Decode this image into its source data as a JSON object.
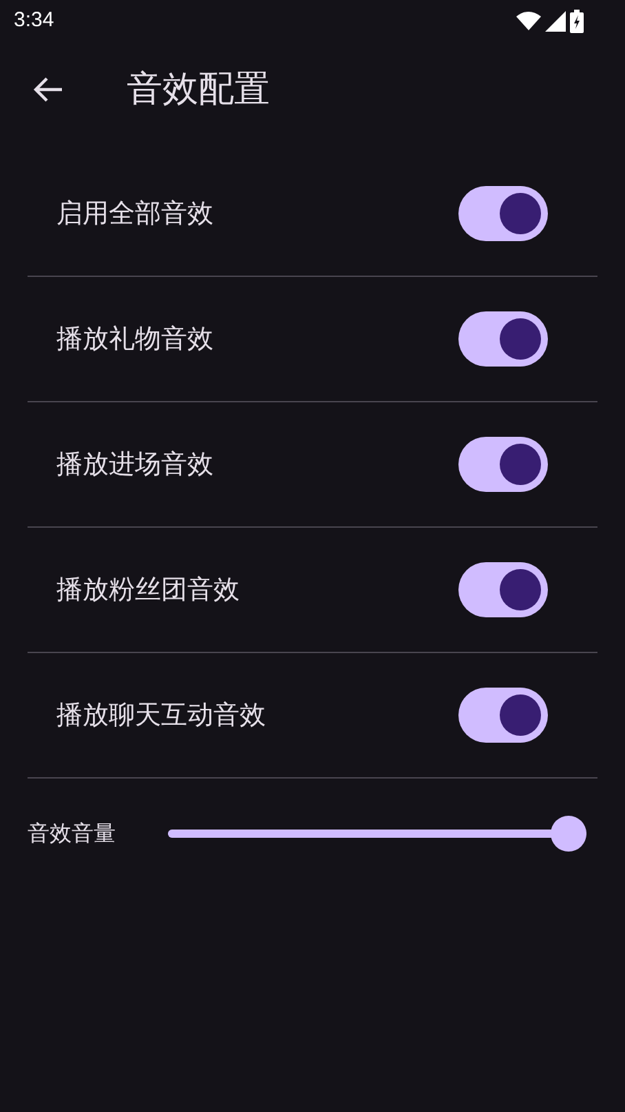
{
  "status_bar": {
    "time": "3:34"
  },
  "app_bar": {
    "title": "音效配置"
  },
  "settings": [
    {
      "label": "启用全部音效",
      "on": true
    },
    {
      "label": "播放礼物音效",
      "on": true
    },
    {
      "label": "播放进场音效",
      "on": true
    },
    {
      "label": "播放粉丝团音效",
      "on": true
    },
    {
      "label": "播放聊天互动音效",
      "on": true
    }
  ],
  "volume": {
    "label": "音效音量",
    "level": 1
  }
}
